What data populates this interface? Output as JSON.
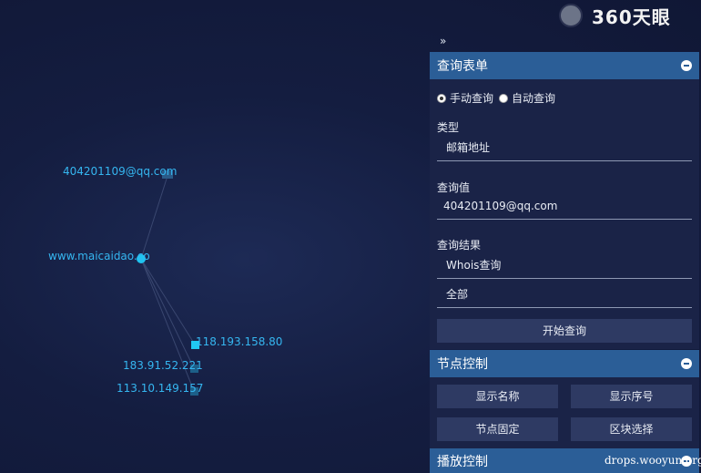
{
  "graph": {
    "nodes": [
      {
        "label": "404201109@qq.com",
        "type": "email"
      },
      {
        "label": "www.maicaidao.co",
        "type": "domain"
      },
      {
        "label": "118.193.158.80",
        "type": "ip"
      },
      {
        "label": "183.91.52.221",
        "type": "ip"
      },
      {
        "label": "113.10.149.157",
        "type": "ip"
      }
    ]
  },
  "logo": {
    "text": "360天眼",
    "icon": "eye-logo-icon"
  },
  "sidebar": {
    "collapse_icon": "»",
    "query_form": {
      "title": "查询表单",
      "mode_manual": "手动查询",
      "mode_auto": "自动查询",
      "type_label": "类型",
      "type_value": "邮箱地址",
      "query_label": "查询值",
      "query_value": "404201109@qq.com",
      "result_label": "查询结果",
      "result_value": "Whois查询",
      "scope_value": "全部",
      "start_button": "开始查询"
    },
    "node_control": {
      "title": "节点控制",
      "show_name": "显示名称",
      "show_index": "显示序号",
      "fix_nodes": "节点固定",
      "block_select": "区块选择"
    },
    "playback_control": {
      "title": "播放控制"
    }
  },
  "watermark": "drops.wooyun.org",
  "colors": {
    "accent": "#2b5e97",
    "node_label": "#35b6f0",
    "panel_bg": "#1a2347",
    "button_bg": "#2e3a63"
  }
}
